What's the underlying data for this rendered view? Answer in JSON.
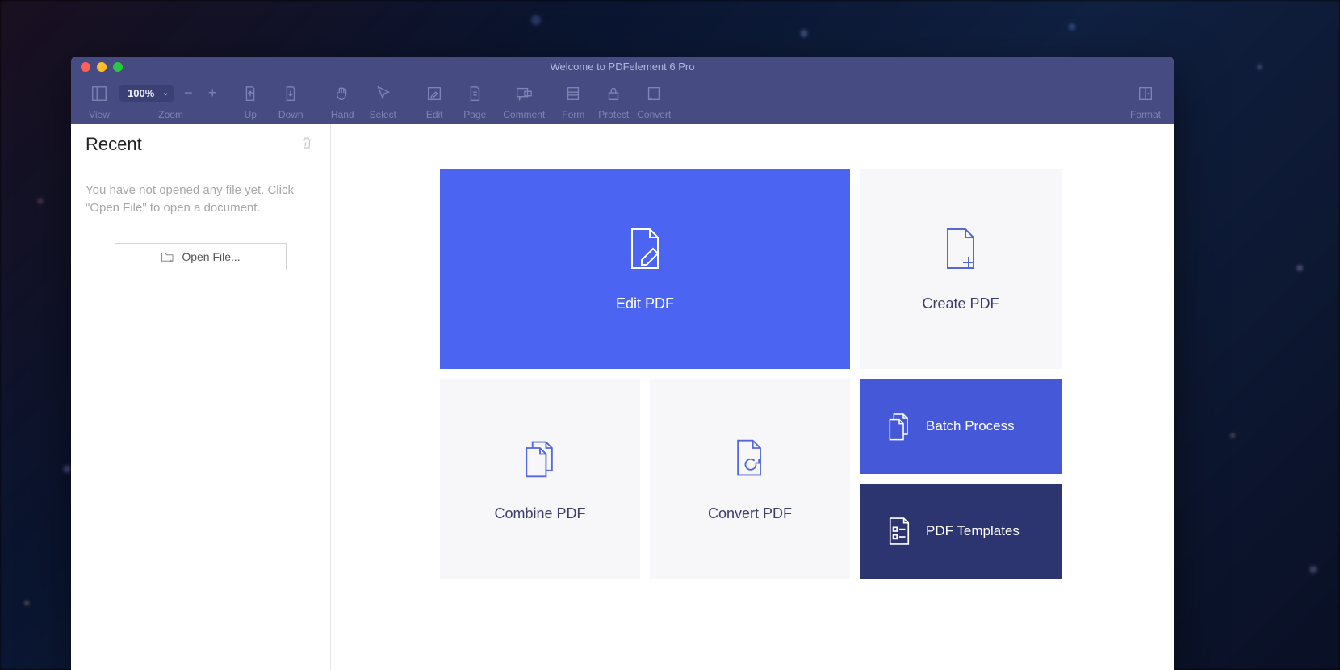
{
  "window": {
    "title": "Welcome to PDFelement 6 Pro"
  },
  "toolbar": {
    "view": "View",
    "zoom_label": "Zoom",
    "zoom_value": "100%",
    "up": "Up",
    "down": "Down",
    "hand": "Hand",
    "select": "Select",
    "edit": "Edit",
    "page": "Page",
    "comment": "Comment",
    "form": "Form",
    "protect": "Protect",
    "convert": "Convert",
    "format": "Format"
  },
  "sidebar": {
    "title": "Recent",
    "empty_msg": "You have not opened any file yet. Click \"Open File\" to open a document.",
    "open_btn": "Open File..."
  },
  "tiles": {
    "edit": "Edit PDF",
    "create": "Create PDF",
    "combine": "Combine PDF",
    "convert": "Convert PDF",
    "batch": "Batch Process",
    "templates": "PDF Templates"
  }
}
